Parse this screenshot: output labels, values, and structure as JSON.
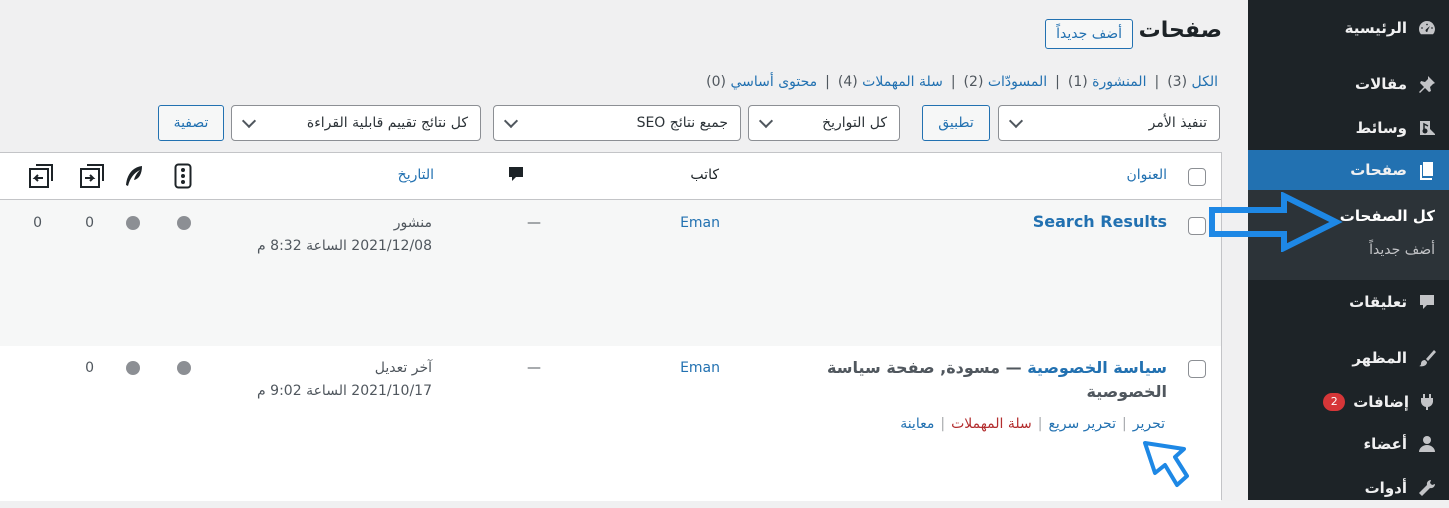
{
  "sidebar": {
    "items": [
      {
        "label": "الرئيسية",
        "icon": "dashboard-icon"
      },
      {
        "label": "مقالات",
        "icon": "pin-icon"
      },
      {
        "label": "وسائط",
        "icon": "media-icon"
      },
      {
        "label": "صفحات",
        "icon": "pages-icon"
      },
      {
        "label": "تعليقات",
        "icon": "comment-icon"
      },
      {
        "label": "المظهر",
        "icon": "brush-icon"
      },
      {
        "label": "إضافات",
        "icon": "plugin-icon",
        "badge": "2"
      },
      {
        "label": "أعضاء",
        "icon": "user-icon"
      },
      {
        "label": "أدوات",
        "icon": "wrench-icon"
      }
    ],
    "submenu": {
      "current": "كل الصفحات",
      "add_new": "أضف جديداً"
    }
  },
  "header": {
    "title": "صفحات",
    "add_new": "أضف جديداً"
  },
  "views": {
    "all": "الكل",
    "all_count": "(3)",
    "published": "المنشورة",
    "published_count": "(1)",
    "drafts": "المسودّات",
    "drafts_count": "(2)",
    "trash": "سلة المهملات",
    "trash_count": "(4)",
    "cornerstone": "محتوى أساسي",
    "cornerstone_count": "(0)"
  },
  "filters": {
    "bulk_action": "تنفيذ الأمر",
    "apply": "تطبيق",
    "dates": "كل التواريخ",
    "seo": "جميع نتائج SEO",
    "readability": "كل نتائج تقييم قابلية القراءة",
    "filter": "تصفية"
  },
  "table": {
    "headers": {
      "title": "العنوان",
      "author": "كاتب",
      "date": "التاريخ"
    },
    "rows": [
      {
        "title": "Search Results",
        "author": "Eman",
        "comments": "—",
        "status": "منشور",
        "date": "2021/12/08 الساعة 8:32 م",
        "links_out": "0",
        "links_in": "0"
      },
      {
        "title": "سياسة الخصوصية",
        "title_suffix": " — مسودة, صفحة سياسة الخصوصية",
        "author": "Eman",
        "comments": "—",
        "status": "آخر تعديل",
        "date": "2021/10/17 الساعة 9:02 م",
        "links_in": "0",
        "actions": {
          "edit": "تحرير",
          "quick_edit": "تحرير سريع",
          "trash": "سلة المهملات",
          "preview": "معاينة"
        }
      }
    ]
  },
  "colors": {
    "accent": "#2271b1",
    "sidebar_bg": "#1d2327",
    "annotation": "#1e88e5"
  }
}
